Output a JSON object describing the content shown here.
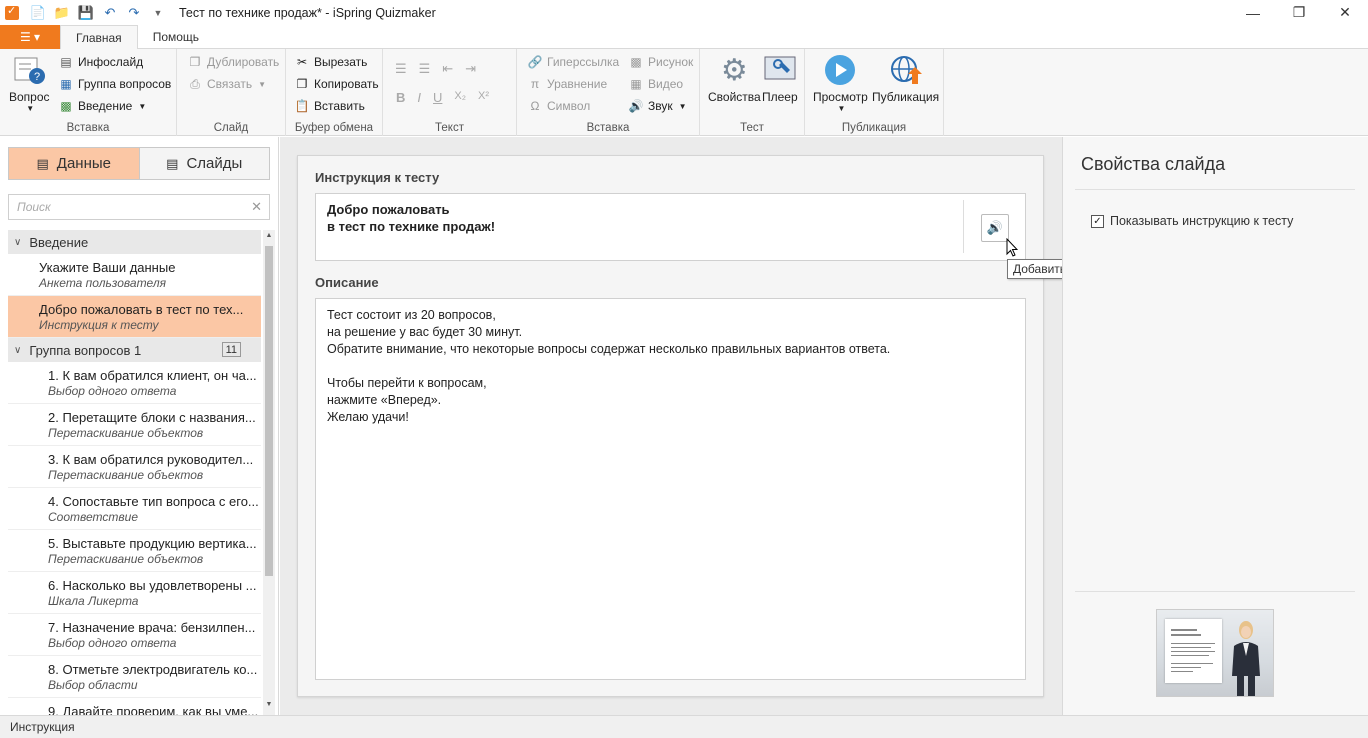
{
  "window": {
    "title": "Тест по технике продаж* - iSpring Quizmaker"
  },
  "ribbon_tabs": {
    "home": "Главная",
    "help": "Помощь"
  },
  "ribbon": {
    "insert_group": {
      "label": "Вставка",
      "question": "Вопрос",
      "infoslide": "Инфослайд",
      "question_group": "Группа вопросов",
      "intro": "Введение"
    },
    "slide_group": {
      "label": "Слайд",
      "duplicate": "Дублировать",
      "link": "Связать"
    },
    "clipboard_group": {
      "label": "Буфер обмена",
      "cut": "Вырезать",
      "copy": "Копировать",
      "paste": "Вставить"
    },
    "text_group": {
      "label": "Текст",
      "bold": "B",
      "italic": "I",
      "underline": "U",
      "subscript": "X₂",
      "superscript": "X²"
    },
    "insert_media_group": {
      "label": "Вставка",
      "hyperlink": "Гиперссылка",
      "equation": "Уравнение",
      "symbol": "Символ",
      "picture": "Рисунок",
      "video": "Видео",
      "sound": "Звук"
    },
    "test_group": {
      "label": "Тест",
      "properties": "Свойства",
      "player": "Плеер"
    },
    "publish_group": {
      "label": "Публикация",
      "preview": "Просмотр",
      "publish": "Публикация"
    }
  },
  "left_panel": {
    "toggle": {
      "data": "Данные",
      "slides": "Слайды"
    },
    "search_placeholder": "Поиск",
    "groups": [
      {
        "title": "Введение",
        "items": [
          {
            "title": "Укажите Ваши данные",
            "subtitle": "Анкета пользователя"
          },
          {
            "title": "Добро пожаловать в тест по тех...",
            "subtitle": "Инструкция к тесту"
          }
        ]
      },
      {
        "title": "Группа вопросов 1",
        "count": "11",
        "items": [
          {
            "title": "1. К вам обратился клиент, он ча...",
            "subtitle": "Выбор одного ответа"
          },
          {
            "title": "2. Перетащите блоки с названия...",
            "subtitle": "Перетаскивание объектов"
          },
          {
            "title": "3. К вам обратился руководител...",
            "subtitle": "Перетаскивание объектов"
          },
          {
            "title": "4. Сопоставьте тип вопроса с его...",
            "subtitle": "Соответствие"
          },
          {
            "title": "5. Выставьте продукцию вертика...",
            "subtitle": "Перетаскивание объектов"
          },
          {
            "title": "6. Насколько вы удовлетворены ...",
            "subtitle": "Шкала Ликерта"
          },
          {
            "title": "7. Назначение врача: бензилпен...",
            "subtitle": "Выбор одного ответа"
          },
          {
            "title": "8. Отметьте электродвигатель ко...",
            "subtitle": "Выбор области"
          },
          {
            "title": "9. Давайте проверим, как вы уме...",
            "subtitle": ""
          }
        ]
      }
    ]
  },
  "editor": {
    "instruction_label": "Инструкция к тесту",
    "instruction_line1": "Добро пожаловать",
    "instruction_line2": "в тест по технике продаж!",
    "description_label": "Описание",
    "description_text": "Тест состоит из 20 вопросов,\nна решение у вас будет 30 минут.\nОбратите внимание, что некоторые вопросы содержат несколько правильных вариантов ответа.\n\nЧтобы перейти к вопросам,\nнажмите «Вперед».\nЖелаю удачи!",
    "tooltip": "Добавить звук"
  },
  "right_panel": {
    "title": "Свойства слайда",
    "show_instruction_label": "Показывать инструкцию к тесту",
    "show_instruction_checked": true
  },
  "status_bar": {
    "text": "Инструкция"
  },
  "colors": {
    "accent": "#f07a1e",
    "selection": "#fbc7a5",
    "sound_icon": "#e8a020",
    "blue_icon": "#2b6cb0"
  }
}
